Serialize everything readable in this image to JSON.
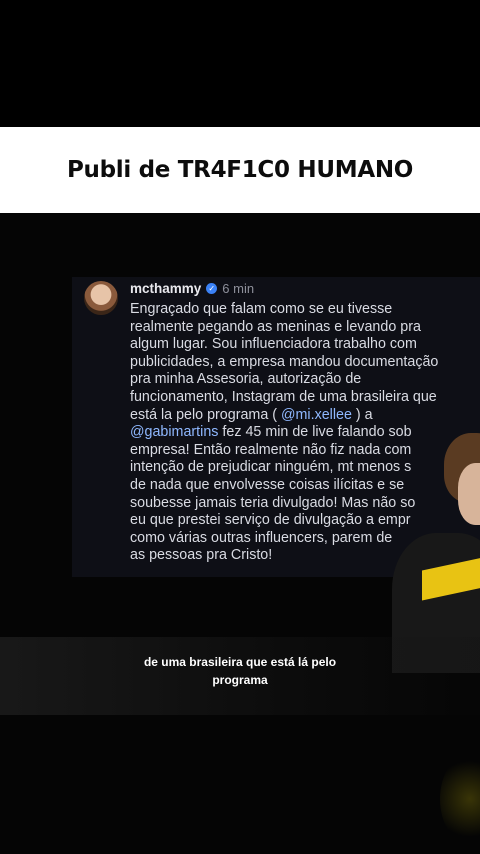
{
  "title": "Publi de TR4F1C0 HUMANO",
  "post": {
    "username": "mcthammy",
    "verified_icon": "verified-check-icon",
    "time": "6 min",
    "text_before_mention1": "Engraçado que falam como se eu tivesse\nrealmente pegando as meninas e levando pra\nalgum lugar. Sou influenciadora trabalho com\npublicidades, a empresa mandou documentação\npra minha Assesoria, autorização de\nfuncionamento, Instagram de uma brasileira que\nestá la pelo programa ( ",
    "mention1": "@mi.xellee",
    "text_between_mentions": " ) a\n",
    "mention2": "@gabimartins",
    "text_after_mention2": "  fez 45 min de live falando sob\nempresa! Então realmente não fiz nada com\nintenção de prejudicar ninguém, mt menos s\nde nada que envolvesse coisas ilícitas e se\nsoubesse jamais teria divulgado! Mas não so\neu que prestei serviço de divulgação a empr\ncomo várias outras influencers, parem de\nas pessoas pra Cristo!"
  },
  "caption": "de uma brasileira que está lá pelo\nprograma",
  "colors": {
    "title_bg": "#ffffff",
    "title_text": "#0c0c0c",
    "post_bg": "#0e0f16",
    "post_text": "#d9dbe3",
    "mention": "#8fb8ff",
    "verified": "#3b82f6"
  }
}
